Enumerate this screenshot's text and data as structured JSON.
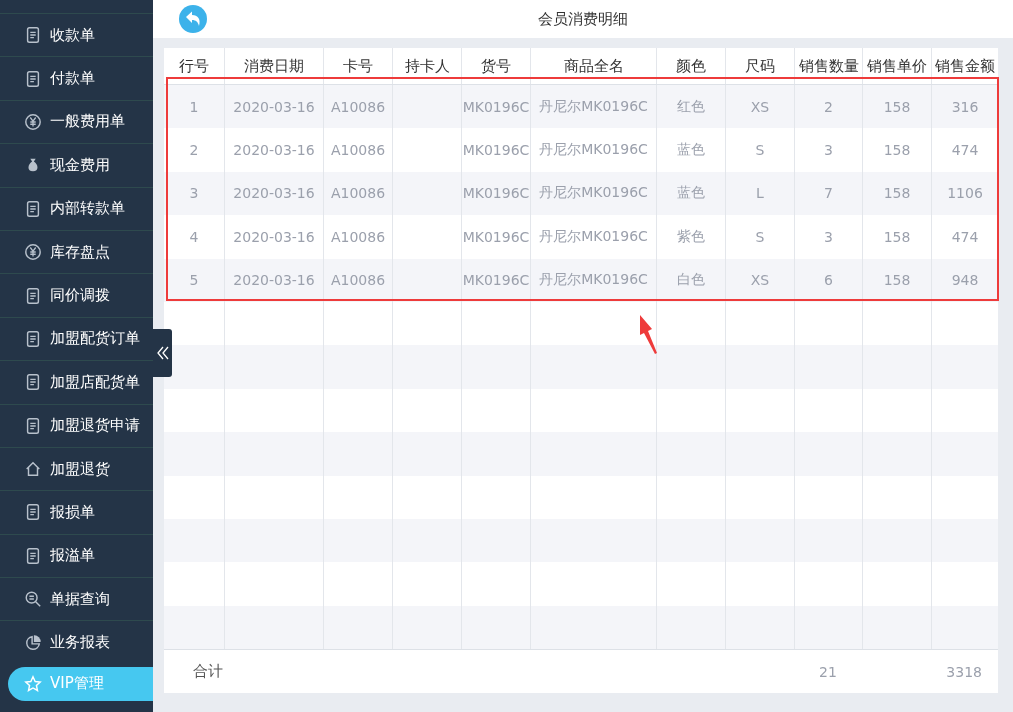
{
  "sidebar": {
    "items": [
      {
        "label": "收款单",
        "selected": false
      },
      {
        "label": "付款单",
        "selected": false
      },
      {
        "label": "一般费用单",
        "selected": false
      },
      {
        "label": "现金费用",
        "selected": false
      },
      {
        "label": "内部转款单",
        "selected": false
      },
      {
        "label": "库存盘点",
        "selected": false
      },
      {
        "label": "同价调拨",
        "selected": false
      },
      {
        "label": "加盟配货订单",
        "selected": false
      },
      {
        "label": "加盟店配货单",
        "selected": false
      },
      {
        "label": "加盟退货申请",
        "selected": false
      },
      {
        "label": "加盟退货",
        "selected": false
      },
      {
        "label": "报损单",
        "selected": false
      },
      {
        "label": "报溢单",
        "selected": false
      },
      {
        "label": "单据查询",
        "selected": false
      },
      {
        "label": "业务报表",
        "selected": false
      },
      {
        "label": "VIP管理",
        "selected": true
      }
    ]
  },
  "header": {
    "title": "会员消费明细"
  },
  "table": {
    "columns": [
      "行号",
      "消费日期",
      "卡号",
      "持卡人",
      "货号",
      "商品全名",
      "颜色",
      "尺码",
      "销售数量",
      "销售单价",
      "销售金额"
    ],
    "rows": [
      [
        "1",
        "2020-03-16",
        "A10086",
        "",
        "MK0196C",
        "丹尼尔MK0196C",
        "红色",
        "XS",
        "2",
        "158",
        "316"
      ],
      [
        "2",
        "2020-03-16",
        "A10086",
        "",
        "MK0196C",
        "丹尼尔MK0196C",
        "蓝色",
        "S",
        "3",
        "158",
        "474"
      ],
      [
        "3",
        "2020-03-16",
        "A10086",
        "",
        "MK0196C",
        "丹尼尔MK0196C",
        "蓝色",
        "L",
        "7",
        "158",
        "1106"
      ],
      [
        "4",
        "2020-03-16",
        "A10086",
        "",
        "MK0196C",
        "丹尼尔MK0196C",
        "紫色",
        "S",
        "3",
        "158",
        "474"
      ],
      [
        "5",
        "2020-03-16",
        "A10086",
        "",
        "MK0196C",
        "丹尼尔MK0196C",
        "白色",
        "XS",
        "6",
        "158",
        "948"
      ]
    ],
    "footer": {
      "label": "合计",
      "total_quantity": "21",
      "total_amount": "3318"
    }
  }
}
